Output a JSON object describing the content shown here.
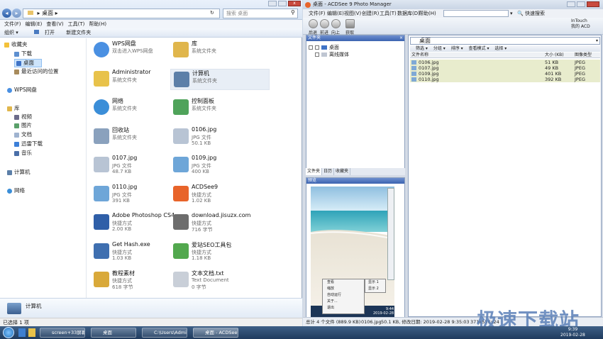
{
  "explorer": {
    "address": "桌面",
    "search_placeholder": "搜索 桌面",
    "menu": [
      "文件(F)",
      "编辑(E)",
      "查看(V)",
      "工具(T)",
      "帮助(H)"
    ],
    "toolbar": [
      "组织 ▾",
      "打开",
      "新建文件夹"
    ],
    "nav": {
      "favorites": "收藏夹",
      "downloads": "下载",
      "desktop": "桌面",
      "recent": "最近访问的位置",
      "wps": "WPS网盘",
      "libraries": "库",
      "videos": "视频",
      "pictures": "图片",
      "documents": "文档",
      "xunlei": "迅雷下载",
      "music": "音乐",
      "computer": "计算机",
      "network": "网络"
    },
    "items": [
      {
        "name": "WPS网盘",
        "line1": "双击进入WPS网盘",
        "line2": ""
      },
      {
        "name": "库",
        "line1": "系统文件夹",
        "line2": ""
      },
      {
        "name": "Administrator",
        "line1": "系统文件夹",
        "line2": ""
      },
      {
        "name": "计算机",
        "line1": "系统文件夹",
        "line2": ""
      },
      {
        "name": "网络",
        "line1": "系统文件夹",
        "line2": ""
      },
      {
        "name": "控制面板",
        "line1": "系统文件夹",
        "line2": ""
      },
      {
        "name": "回收站",
        "line1": "系统文件夹",
        "line2": ""
      },
      {
        "name": "0106.jpg",
        "line1": "JPG 文件",
        "line2": "50.1 KB"
      },
      {
        "name": "0107.jpg",
        "line1": "JPG 文件",
        "line2": "48.7 KB"
      },
      {
        "name": "0109.jpg",
        "line1": "JPG 文件",
        "line2": "400 KB"
      },
      {
        "name": "0110.jpg",
        "line1": "JPG 文件",
        "line2": "391 KB"
      },
      {
        "name": "ACDSee9",
        "line1": "快捷方式",
        "line2": "1.02 KB"
      },
      {
        "name": "Adobe Photoshop CS4",
        "line1": "快捷方式",
        "line2": "2.00 KB"
      },
      {
        "name": "download.jisuzx.com",
        "line1": "快捷方式",
        "line2": "716 字节"
      },
      {
        "name": "Get Hash.exe",
        "line1": "快捷方式",
        "line2": "1.03 KB"
      },
      {
        "name": "爱站SEO工具包",
        "line1": "快捷方式",
        "line2": "1.18 KB"
      },
      {
        "name": "教程素材",
        "line1": "快捷方式",
        "line2": "618 字节"
      },
      {
        "name": "文本文档.txt",
        "line1": "Text Document",
        "line2": "0 字节"
      }
    ],
    "details_name": "计算机",
    "status": "已选择 1 项"
  },
  "acdsee": {
    "title": "桌面 - ACDSee 9 Photo Manager",
    "menu": [
      "文件(F)",
      "编辑(E)",
      "视图(V)",
      "创建(R)",
      "工具(T)",
      "数据库(D)",
      "帮助(H)"
    ],
    "quick_search": "快速搜索",
    "toolbar": [
      "后退",
      "前进",
      "向上",
      "获取"
    ],
    "brand1": "InTouch",
    "brand2": "我的 ACD",
    "folder_pane_title": "文件夹",
    "tree": [
      "桌面",
      "离线媒体"
    ],
    "tabs": [
      "文件夹",
      "日历",
      "收藏夹"
    ],
    "preview_title": "预览",
    "context_menu": [
      "查看",
      "缩放",
      "自动运行",
      "关于...",
      "退出"
    ],
    "submenu": [
      "显示 1",
      "显示 2"
    ],
    "preview_caption_time": "9:44",
    "preview_caption_date": "2019-02-28",
    "path": "桌面",
    "list_toolbar": [
      "筛选 ▾",
      "分组 ▾",
      "排序 ▾",
      "查看模式 ▾",
      "选择 ▾"
    ],
    "columns": [
      "文件名称",
      "大小 (KB)",
      "图像类型"
    ],
    "files": [
      {
        "name": "0106.jpg",
        "size": "51 KB",
        "type": "JPEG"
      },
      {
        "name": "0107.jpg",
        "size": "49 KB",
        "type": "JPEG"
      },
      {
        "name": "0109.jpg",
        "size": "401 KB",
        "type": "JPEG"
      },
      {
        "name": "0110.jpg",
        "size": "392 KB",
        "type": "JPEG"
      }
    ],
    "status": {
      "total": "总计 4 个文件 (889.9 KB)",
      "file": "0106.jpg",
      "info": "50.1 KB, 修改日期: 2019-02-28 9:35:03",
      "dims": "371x556x24"
    }
  },
  "taskbar": {
    "buttons": [
      "screen+33屏幕软件...",
      "桌面",
      "C:\\Users\\Admi...",
      "桌面 - ACDSee 9..."
    ],
    "time": "9:39",
    "date": "2019-02-28"
  },
  "watermark": "极速下载站",
  "colors": {
    "accent": "#3b63b0",
    "selected": "#cde4fb",
    "taskbar": "#2b4a72"
  }
}
